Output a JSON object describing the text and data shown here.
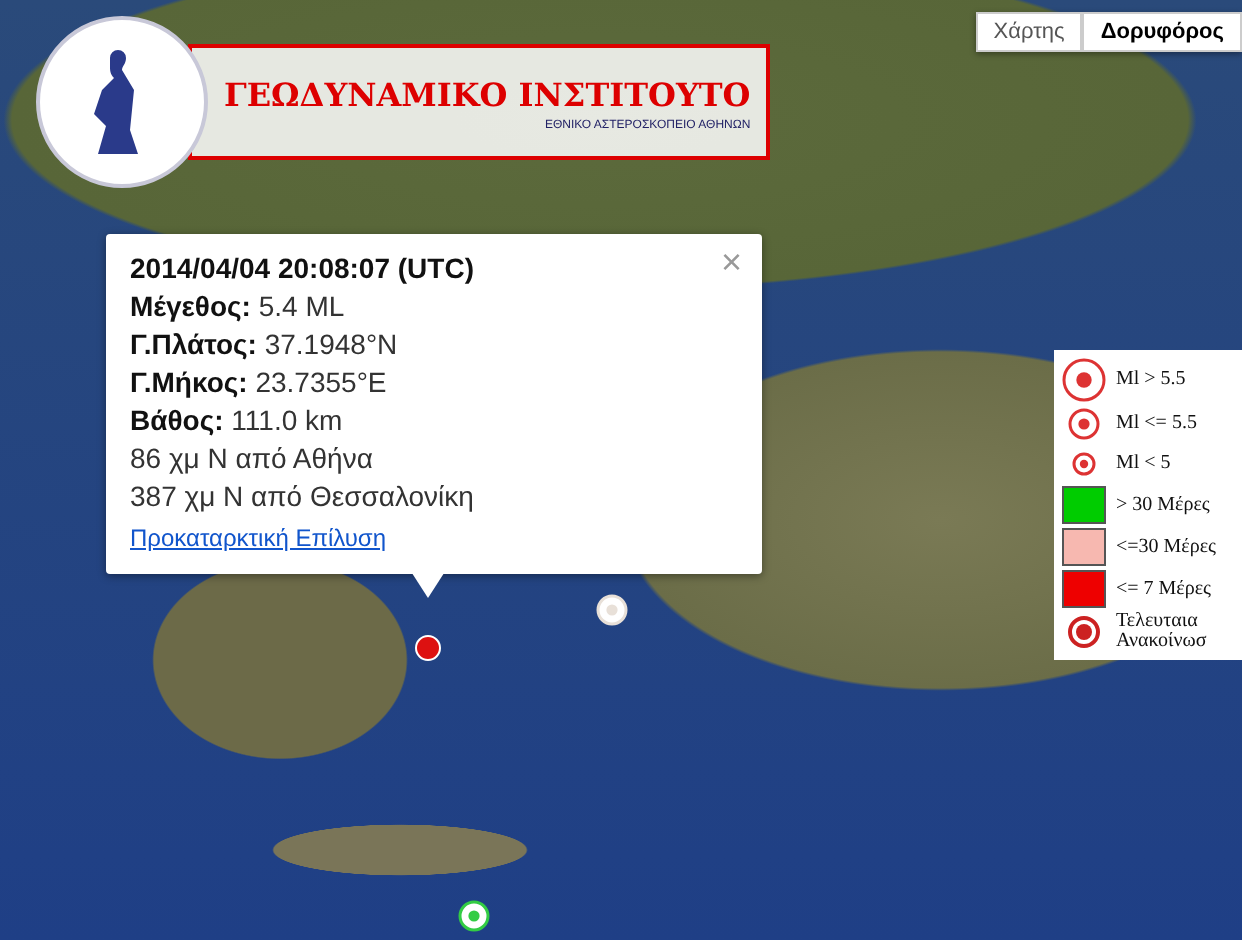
{
  "logo": {
    "title": "ΓΕΩΔΥΝΑΜΙΚΟ ΙΝΣΤΙΤΟΥΤΟ",
    "subtitle": "ΕΘΝΙΚΟ ΑΣΤΕΡΟΣΚΟΠΕΙΟ ΑΘΗΝΩΝ"
  },
  "map_types": [
    {
      "label": "Χάρτης",
      "selected": false
    },
    {
      "label": "Δορυφόρος",
      "selected": true
    }
  ],
  "popup": {
    "title": "2014/04/04 20:08:07 (UTC)",
    "close": "×",
    "fields": [
      {
        "label": "Μέγεθος:",
        "value": "5.4 ML"
      },
      {
        "label": "Γ.Πλάτος:",
        "value": "37.1948°N"
      },
      {
        "label": "Γ.Μήκος:",
        "value": "23.7355°E"
      },
      {
        "label": "Βάθος:",
        "value": "111.0 km"
      }
    ],
    "lines": [
      "86 χμ Ν από Αθήνα",
      "387 χμ Ν από Θεσσαλονίκη"
    ],
    "link": "Προκαταρκτική Επίλυση"
  },
  "legend": [
    {
      "kind": "ring",
      "label": "Ml > 5.5"
    },
    {
      "kind": "ring",
      "label": "Ml <= 5.5"
    },
    {
      "kind": "ring",
      "label": "Ml < 5"
    },
    {
      "kind": "swatch",
      "color": "#00cc00",
      "label": "> 30 Μέρες"
    },
    {
      "kind": "swatch",
      "color": "#f7b8b0",
      "label": "<=30 Μέρες"
    },
    {
      "kind": "swatch",
      "color": "#ee0000",
      "label": "<= 7 Μέρες"
    },
    {
      "kind": "latest",
      "label": "Τελευταια Ανακοίνωσ"
    }
  ],
  "markers": [
    {
      "kind": "latest",
      "color": "#dd1111"
    },
    {
      "kind": "ring",
      "color": "#33cc44"
    },
    {
      "kind": "ring",
      "color": "#e8e0d8"
    }
  ]
}
